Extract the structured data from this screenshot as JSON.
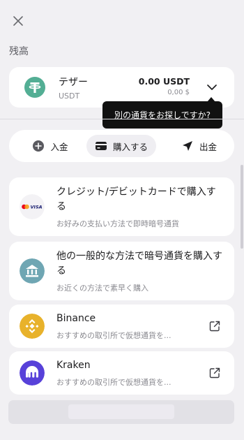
{
  "header": {
    "section_title": "残高"
  },
  "asset": {
    "name": "テザー",
    "ticker": "USDT",
    "amount": "0.00 USDT",
    "fiat": "0,00 $",
    "logo_color": "#53ae94"
  },
  "tooltip": {
    "text": "別の通貨をお探しですか?"
  },
  "tabs": [
    {
      "label": "入金",
      "icon": "plus-circle-icon"
    },
    {
      "label": "購入する",
      "icon": "card-icon",
      "active": true
    },
    {
      "label": "出金",
      "icon": "send-icon"
    }
  ],
  "methods": [
    {
      "title": "クレジット/デビットカードで購入する",
      "subtitle": "お好みの支払い方法で即時暗号通貨",
      "icon": "mastercard-visa-icon"
    },
    {
      "title": "他の一般的な方法で暗号通貨を購入する",
      "subtitle": "お近くの方法で素早く購入",
      "icon": "bank-icon"
    },
    {
      "title": "Binance",
      "subtitle": "おすすめの取引所で仮想通貨を...",
      "icon": "binance-icon",
      "external": true
    },
    {
      "title": "Kraken",
      "subtitle": "おすすめの取引所で仮想通貨を...",
      "icon": "kraken-icon",
      "external": true
    }
  ],
  "colors": {
    "background": "#f1f0f3",
    "tether": "#53ae94",
    "binance": "#e8b22b",
    "kraken": "#5741d9",
    "bank": "#6fa6b3"
  }
}
